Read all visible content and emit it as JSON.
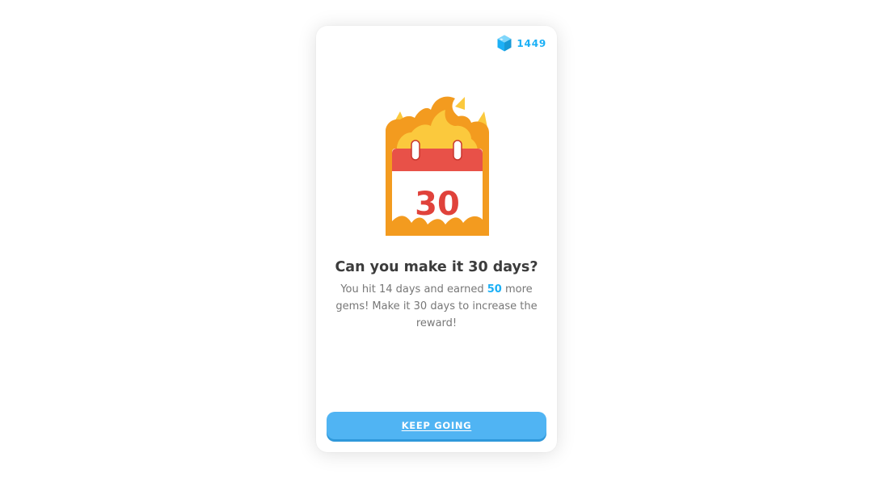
{
  "gems": {
    "count": "1449",
    "icon": "gem-icon",
    "color": "#1cb0f6"
  },
  "illustration": {
    "icon": "streak-calendar-flame-icon",
    "calendar_number": "30",
    "colors": {
      "flame_outer": "#f39b1f",
      "flame_inner": "#fbc93d",
      "calendar_header": "#e85148",
      "calendar_number": "#e0423b",
      "calendar_body": "#ffffff"
    }
  },
  "message": {
    "title": "Can you make it 30 days?",
    "body_prefix": "You hit 14 days and earned ",
    "gems_earned": "50",
    "body_suffix": " more gems! Make it 30 days to increase the reward!"
  },
  "actions": {
    "keep_going_label": "KEEP GOING",
    "button_color": "#50b4f3"
  }
}
